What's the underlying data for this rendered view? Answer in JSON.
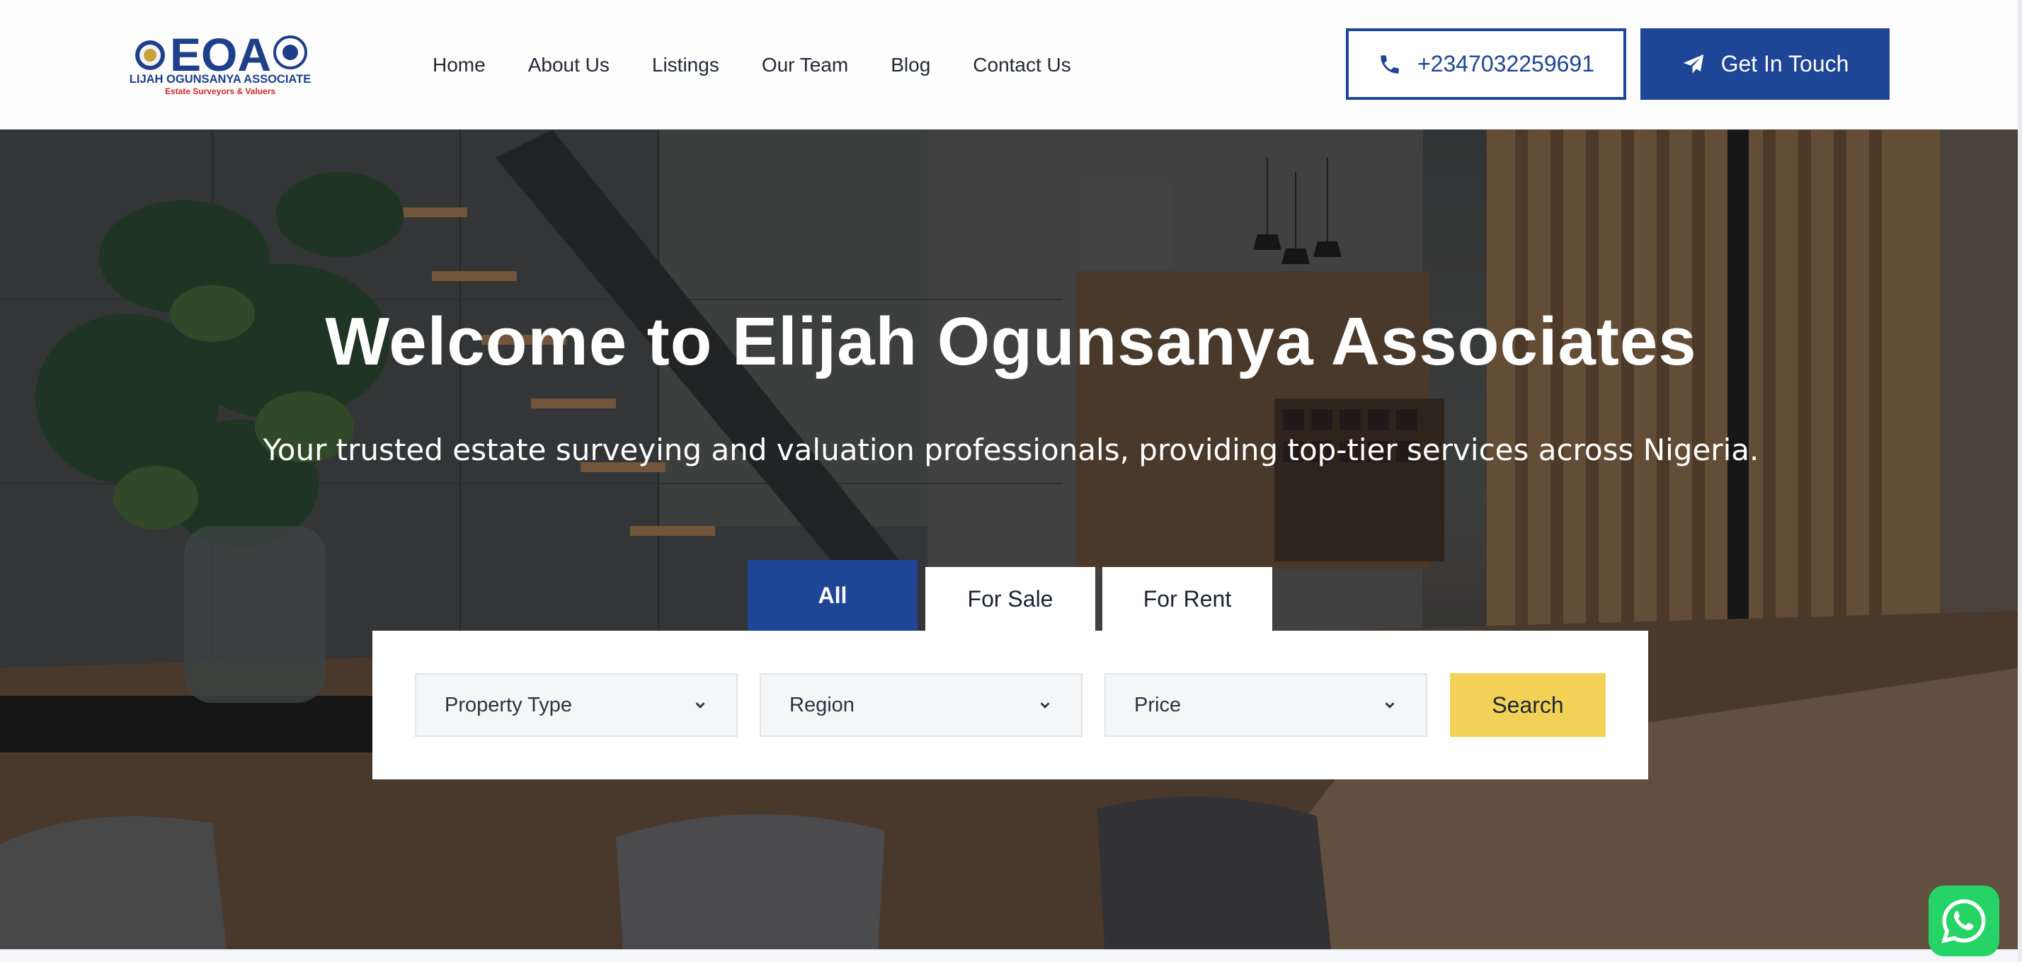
{
  "brand": {
    "logo_letters": "EOA",
    "logo_name": "ELIJAH OGUNSANYA ASSOCIATES",
    "logo_tagline": "Estate Surveyors & Valuers"
  },
  "nav": {
    "items": [
      "Home",
      "About Us",
      "Listings",
      "Our Team",
      "Blog",
      "Contact Us"
    ]
  },
  "header_actions": {
    "phone": "+2347032259691",
    "cta_label": "Get In Touch"
  },
  "hero": {
    "title": "Welcome to Elijah Ogunsanya Associates",
    "subtitle": "Your trusted estate surveying and valuation professionals, providing top-tier services across Nigeria."
  },
  "search": {
    "tabs": [
      {
        "label": "All",
        "active": true
      },
      {
        "label": "For Sale",
        "active": false
      },
      {
        "label": "For Rent",
        "active": false
      }
    ],
    "property_type": "Property Type",
    "region": "Region",
    "price": "Price",
    "button_label": "Search"
  },
  "icons": {
    "phone": "phone-icon",
    "cta": "paper-plane-icon",
    "dropdown": "chevron-down-icon",
    "chat": "whatsapp-icon"
  },
  "colors": {
    "primary": "#1e4596",
    "accent": "#f2d256",
    "whatsapp": "#25d366"
  }
}
